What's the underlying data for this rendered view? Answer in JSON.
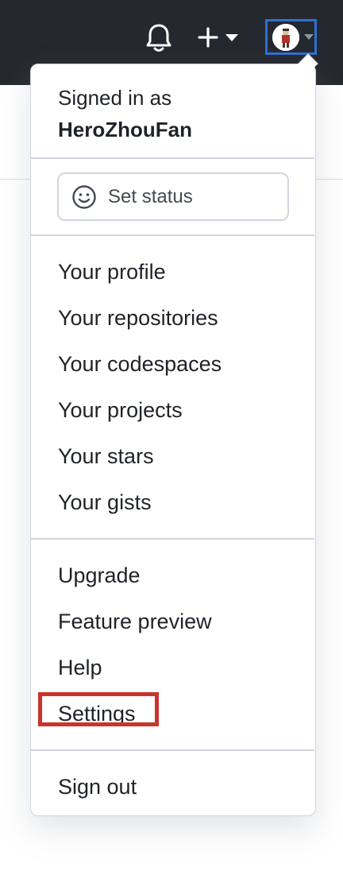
{
  "header": {
    "notifications_icon": "bell-icon",
    "create_icon": "plus-icon",
    "avatar_icon": "avatar",
    "colors": {
      "bar": "#24292f",
      "highlight_avatar": "#2f6fd1",
      "highlight_settings": "#c9342c"
    }
  },
  "menu": {
    "signed_in_label": "Signed in as",
    "username": "HeroZhouFan",
    "set_status_label": "Set status",
    "profile_items": [
      "Your profile",
      "Your repositories",
      "Your codespaces",
      "Your projects",
      "Your stars",
      "Your gists"
    ],
    "other_items": [
      "Upgrade",
      "Feature preview",
      "Help",
      "Settings"
    ],
    "sign_out_label": "Sign out"
  }
}
